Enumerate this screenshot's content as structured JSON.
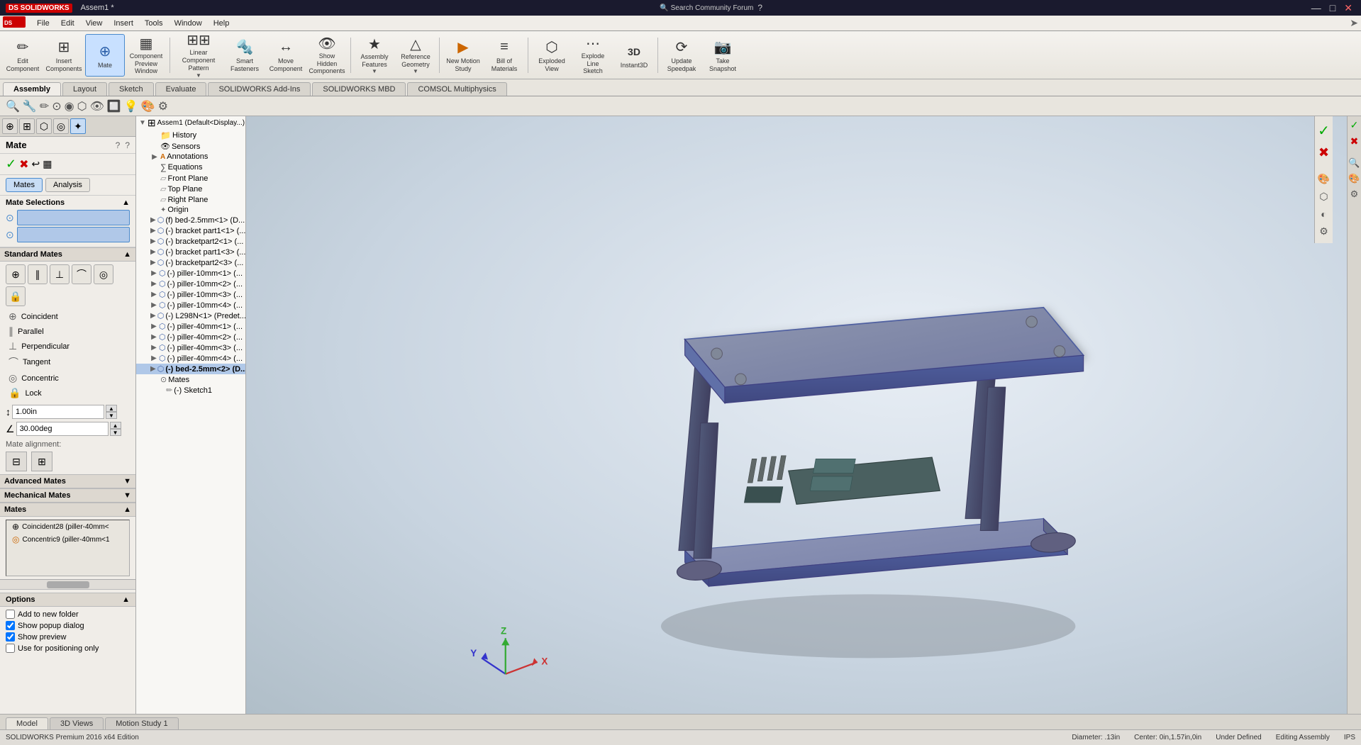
{
  "window": {
    "title": "Assem1 *",
    "title_bar_bg": "#1e1e2e"
  },
  "logo": "DS SOLIDWORKS",
  "menu": {
    "items": [
      "File",
      "Edit",
      "View",
      "Insert",
      "Tools",
      "Window",
      "Help"
    ]
  },
  "toolbar": {
    "buttons": [
      {
        "id": "edit-component",
        "label": "Edit\nComponent",
        "icon": "✏"
      },
      {
        "id": "insert-components",
        "label": "Insert\nComponents",
        "icon": "⊞"
      },
      {
        "id": "mate",
        "label": "Mate",
        "icon": "⊕"
      },
      {
        "id": "component-preview",
        "label": "Component\nPreview\nWindow",
        "icon": "▦"
      },
      {
        "id": "linear-component-pattern",
        "label": "Linear Component\nPattern",
        "icon": "⋮⋮"
      },
      {
        "id": "smart-fasteners",
        "label": "Smart\nFasteners",
        "icon": "🔩"
      },
      {
        "id": "move-component",
        "label": "Move\nComponent",
        "icon": "↔"
      },
      {
        "id": "show-hidden-components",
        "label": "Show\nHidden\nComponents",
        "icon": "👁"
      },
      {
        "id": "assembly-features",
        "label": "Assembly\nFeatures",
        "icon": "★"
      },
      {
        "id": "reference-geometry",
        "label": "Reference\nGeometry",
        "icon": "△"
      },
      {
        "id": "new-motion-study",
        "label": "New Motion\nStudy",
        "icon": "▶"
      },
      {
        "id": "bill-of-materials",
        "label": "Bill of\nMaterials",
        "icon": "≡"
      },
      {
        "id": "exploded-view",
        "label": "Exploded\nView",
        "icon": "⬡"
      },
      {
        "id": "explode-line-sketch",
        "label": "Explode\nLine\nSketch",
        "icon": "⋯"
      },
      {
        "id": "instant3d",
        "label": "Instant3D",
        "icon": "3D"
      },
      {
        "id": "update-speedpak",
        "label": "Update\nSpeedpak",
        "icon": "⟳"
      },
      {
        "id": "take-snapshot",
        "label": "Take\nSnapshot",
        "icon": "📷"
      }
    ]
  },
  "tabs": {
    "items": [
      "Assembly",
      "Layout",
      "Sketch",
      "Evaluate",
      "SOLIDWORKS Add-Ins",
      "SOLIDWORKS MBD",
      "COMSOL Multiphysics"
    ],
    "active": "Assembly"
  },
  "left_panel": {
    "section": "Mate",
    "help_icon": "?",
    "question_icon": "?",
    "icons": [
      "⊕",
      "✖",
      "↩",
      "▦"
    ],
    "tabs": [
      {
        "id": "mates",
        "label": "Mates"
      },
      {
        "id": "analysis",
        "label": "Analysis"
      }
    ],
    "active_tab": "mates",
    "mate_selections_label": "Mate Selections",
    "collapse_icon": "▲",
    "standard_mates_label": "Standard Mates",
    "standard_mates_collapse": "▲",
    "mate_types": [
      {
        "id": "coincident",
        "label": "Coincident"
      },
      {
        "id": "parallel",
        "label": "Parallel"
      },
      {
        "id": "perpendicular",
        "label": "Perpendicular"
      },
      {
        "id": "tangent",
        "label": "Tangent"
      },
      {
        "id": "concentric",
        "label": "Concentric"
      },
      {
        "id": "lock",
        "label": "Lock"
      }
    ],
    "distance_value": "1.00in",
    "angle_value": "30.00deg",
    "mate_alignment_label": "Mate alignment:",
    "advanced_mates_label": "Advanced Mates",
    "mechanical_mates_label": "Mechanical Mates",
    "mates_section_label": "Mates",
    "mates_list": [
      {
        "id": "coincident28",
        "label": "Coincident28 (piller-40mm<",
        "color": "#888"
      },
      {
        "id": "concentric9",
        "label": "Concentric9 (piller-40mm<1",
        "color": "#cc6600"
      }
    ],
    "options_label": "Options",
    "options_items": [
      {
        "id": "add-to-new-folder",
        "label": "Add to new folder",
        "checked": false
      },
      {
        "id": "show-popup-dialog",
        "label": "Show popup dialog",
        "checked": true
      },
      {
        "id": "show-preview",
        "label": "Show preview",
        "checked": true
      },
      {
        "id": "use-for-positioning-only",
        "label": "Use for positioning only",
        "checked": false
      }
    ]
  },
  "feature_tree": {
    "root": "Assem1 (Default<Display...)",
    "items": [
      {
        "id": "history",
        "label": "History",
        "icon": "folder",
        "indent": 1
      },
      {
        "id": "sensors",
        "label": "Sensors",
        "icon": "sensor",
        "indent": 1
      },
      {
        "id": "annotations",
        "label": "Annotations",
        "icon": "annotation",
        "indent": 1
      },
      {
        "id": "equations",
        "label": "Equations",
        "icon": "equation",
        "indent": 1
      },
      {
        "id": "front-plane",
        "label": "Front Plane",
        "icon": "plane",
        "indent": 1
      },
      {
        "id": "top-plane",
        "label": "Top Plane",
        "icon": "plane",
        "indent": 1
      },
      {
        "id": "right-plane",
        "label": "Right Plane",
        "icon": "plane",
        "indent": 1
      },
      {
        "id": "origin",
        "label": "Origin",
        "icon": "origin",
        "indent": 1
      },
      {
        "id": "bed-2.5mm-1",
        "label": "(f) bed-2.5mm<1> (D...",
        "icon": "part",
        "indent": 1,
        "expanded": false
      },
      {
        "id": "bracket-part1-1",
        "label": "(-) bracket part1<1> (...",
        "icon": "part",
        "indent": 1
      },
      {
        "id": "bracket-part2-1",
        "label": "(-) bracketpart2<1> (...",
        "icon": "part",
        "indent": 1
      },
      {
        "id": "bracket-part1-3",
        "label": "(-) bracket part1<3> (...",
        "icon": "part",
        "indent": 1
      },
      {
        "id": "bracket-part2-3",
        "label": "(-) bracketpart2<3> (...",
        "icon": "part",
        "indent": 1
      },
      {
        "id": "piller-10mm-1",
        "label": "(-) piller-10mm<1> (...",
        "icon": "part",
        "indent": 1
      },
      {
        "id": "piller-10mm-2",
        "label": "(-) piller-10mm<2> (...",
        "icon": "part",
        "indent": 1
      },
      {
        "id": "piller-10mm-3",
        "label": "(-) piller-10mm<3> (...",
        "icon": "part",
        "indent": 1
      },
      {
        "id": "piller-10mm-4",
        "label": "(-) piller-10mm<4> (...",
        "icon": "part",
        "indent": 1
      },
      {
        "id": "L298N-1",
        "label": "(-) L298N<1> (Predet...",
        "icon": "part",
        "indent": 1
      },
      {
        "id": "piller-40mm-1",
        "label": "(-) piller-40mm<1> (...",
        "icon": "part",
        "indent": 1
      },
      {
        "id": "piller-40mm-2",
        "label": "(-) piller-40mm<2> (...",
        "icon": "part",
        "indent": 1
      },
      {
        "id": "piller-40mm-3",
        "label": "(-) piller-40mm<3> (...",
        "icon": "part",
        "indent": 1
      },
      {
        "id": "piller-40mm-4",
        "label": "(-) piller-40mm<4> (...",
        "icon": "part",
        "indent": 1
      },
      {
        "id": "bed-2.5mm-2",
        "label": "(-) bed-2.5mm<2> (D...",
        "icon": "part",
        "indent": 1,
        "selected": true
      },
      {
        "id": "mates-node",
        "label": "Mates",
        "icon": "mate",
        "indent": 1
      },
      {
        "id": "sketch1",
        "label": "(-) Sketch1",
        "icon": "sketch",
        "indent": 1
      }
    ]
  },
  "viewport": {
    "model_desc": "3D assembly - robot chassis with pillars and motor driver board"
  },
  "right_side_icons": [
    "✓",
    "✖",
    "🔍",
    "🎨",
    "⚙"
  ],
  "status_bar": {
    "diameter": "Diameter: .13in",
    "center": "Center: 0in,1.57in,0in",
    "status": "Under Defined",
    "mode": "Editing Assembly",
    "units": "IPS"
  },
  "bottom_tabs": [
    {
      "id": "model",
      "label": "Model"
    },
    {
      "id": "3d-views",
      "label": "3D Views"
    },
    {
      "id": "motion-study-1",
      "label": "Motion Study 1"
    }
  ],
  "bottom_active_tab": "Model",
  "command_manager_icons": [
    "🔍",
    "🔧",
    "✏",
    "⊙",
    "◉",
    "⬡",
    "👁",
    "🔲",
    "💡",
    "🎨",
    "⚙"
  ],
  "titlebar_controls": [
    "—",
    "□",
    "✕"
  ]
}
